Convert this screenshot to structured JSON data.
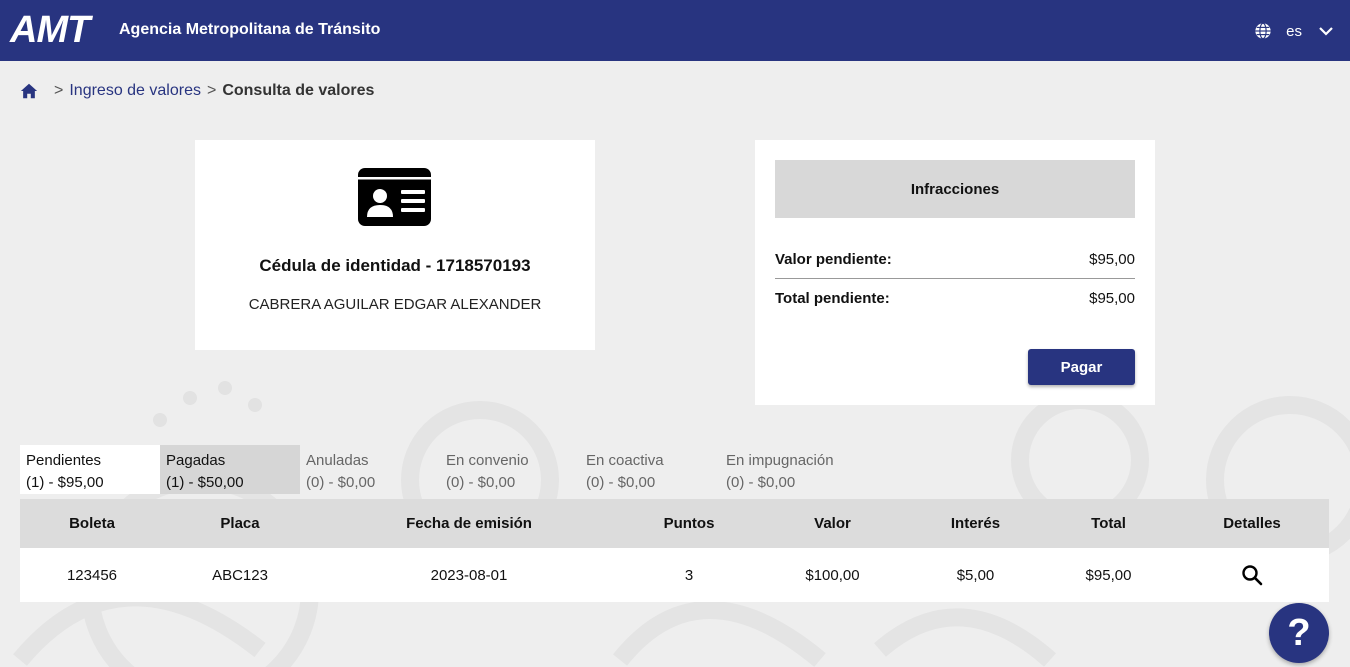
{
  "header": {
    "logo": "AMT",
    "agency": "Agencia Metropolitana de Tránsito",
    "language": "es"
  },
  "breadcrumb": {
    "sep1": ">",
    "link": "Ingreso de valores",
    "sep2": ">",
    "current": "Consulta de valores"
  },
  "person": {
    "document": "Cédula de identidad - 1718570193",
    "name": "CABRERA AGUILAR EDGAR ALEXANDER"
  },
  "infractions": {
    "title": "Infracciones",
    "pending_label": "Valor pendiente:",
    "pending_value": "$95,00",
    "total_label": "Total pendiente:",
    "total_value": "$95,00",
    "pay_label": "Pagar"
  },
  "tabs": [
    {
      "label": "Pendientes",
      "count": "(1) - $95,00"
    },
    {
      "label": "Pagadas",
      "count": "(1) - $50,00"
    },
    {
      "label": "Anuladas",
      "count": "(0) - $0,00"
    },
    {
      "label": "En convenio",
      "count": "(0) - $0,00"
    },
    {
      "label": "En coactiva",
      "count": "(0) - $0,00"
    },
    {
      "label": "En impugnación",
      "count": "(0) - $0,00"
    }
  ],
  "table": {
    "headers": [
      "Boleta",
      "Placa",
      "Fecha de emisión",
      "Puntos",
      "Valor",
      "Interés",
      "Total",
      "Detalles"
    ],
    "rows": [
      [
        "123456",
        "ABC123",
        "2023-08-01",
        "3",
        "$100,00",
        "$5,00",
        "$95,00"
      ]
    ]
  },
  "help": "?",
  "colors": {
    "primary": "#283480",
    "background": "#eeeeee",
    "header_cell": "#dcdcdc"
  },
  "icons": {
    "home": "home-icon",
    "globe": "globe-icon",
    "chevron": "chevron-down-icon",
    "id_card": "id-card-icon",
    "details": "search-icon"
  }
}
